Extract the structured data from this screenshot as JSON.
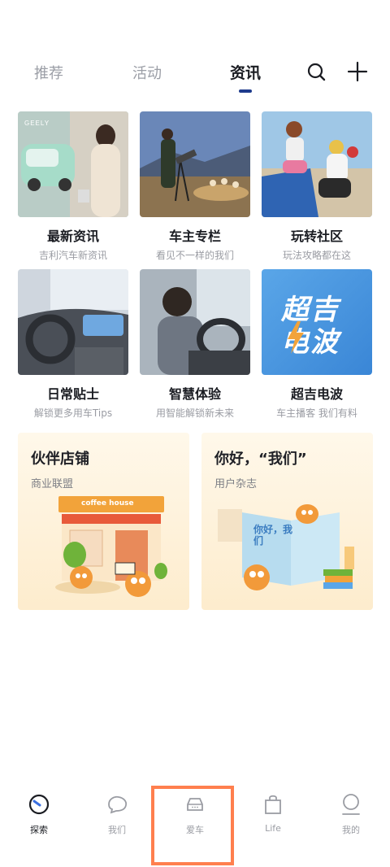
{
  "tabs": [
    {
      "label": "推荐",
      "active": false
    },
    {
      "label": "活动",
      "active": false
    },
    {
      "label": "资讯",
      "active": true
    }
  ],
  "icons": {
    "search": "search-icon",
    "add": "plus-icon"
  },
  "cards": [
    {
      "title": "最新资讯",
      "sub": "吉利汽车新资讯",
      "brand": "GEELY"
    },
    {
      "title": "车主专栏",
      "sub": "看见不一样的我们"
    },
    {
      "title": "玩转社区",
      "sub": "玩法攻略都在这"
    },
    {
      "title": "日常贴士",
      "sub": "解锁更多用车Tips"
    },
    {
      "title": "智慧体验",
      "sub": "用智能解锁新未来"
    },
    {
      "title": "超吉电波",
      "sub": "车主播客 我们有料",
      "art_line1": "超吉",
      "art_line2": "电波"
    }
  ],
  "big_cards": [
    {
      "title": "伙伴店铺",
      "sub": "商业联盟",
      "sign": "coffee house"
    },
    {
      "title": "你好，“我们”",
      "sub": "用户杂志",
      "book_text": "你好，我们"
    }
  ],
  "nav": [
    {
      "label": "探索",
      "icon": "explore-icon",
      "active": true
    },
    {
      "label": "我们",
      "icon": "chat-bubble-icon",
      "active": false
    },
    {
      "label": "爱车",
      "icon": "car-icon",
      "active": false
    },
    {
      "label": "Life",
      "icon": "shopping-bag-icon",
      "active": false
    },
    {
      "label": "我的",
      "icon": "person-icon",
      "active": false
    }
  ],
  "colors": {
    "accent": "#1e3b8c",
    "highlight": "#ff7f4e",
    "inactive": "#9a9ca3"
  }
}
